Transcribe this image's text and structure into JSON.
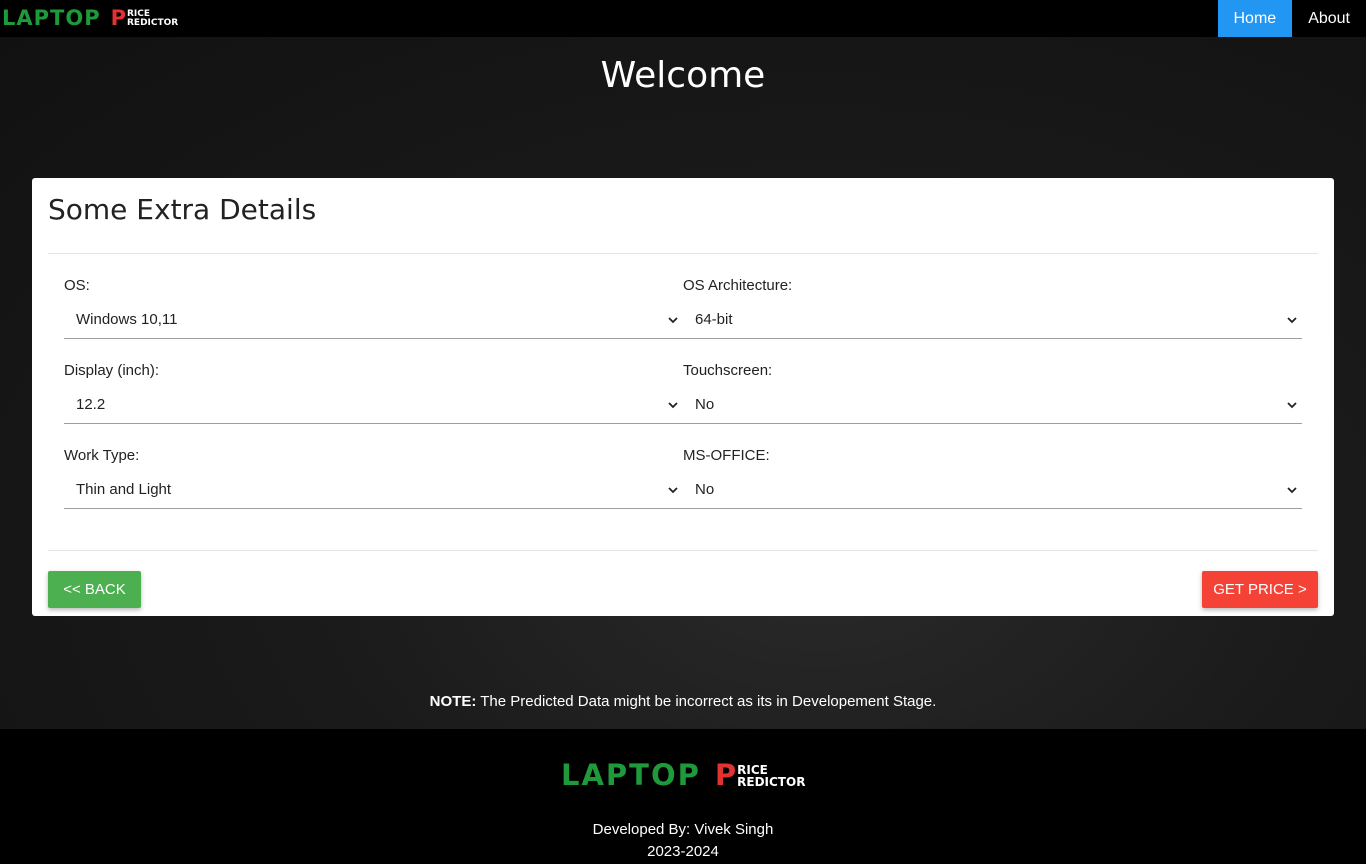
{
  "nav": {
    "logo": {
      "word": "LAPTOP",
      "p": "P",
      "line1": "RICE",
      "line2": "REDICTOR"
    },
    "links": [
      {
        "label": "Home",
        "active": true
      },
      {
        "label": "About",
        "active": false
      }
    ]
  },
  "hero": {
    "title": "Welcome"
  },
  "card": {
    "title": "Some Extra Details",
    "fields": {
      "os": {
        "label": "OS:",
        "value": "Windows 10,11"
      },
      "os_arch": {
        "label": "OS Architecture:",
        "value": "64-bit"
      },
      "display": {
        "label": "Display (inch):",
        "value": "12.2"
      },
      "touch": {
        "label": "Touchscreen:",
        "value": "No"
      },
      "work": {
        "label": "Work Type:",
        "value": "Thin and Light"
      },
      "office": {
        "label": "MS-OFFICE:",
        "value": "No"
      }
    },
    "back_label": "<< BACK",
    "get_label": "GET PRICE >"
  },
  "note": {
    "bold": "NOTE:",
    "text": " The Predicted Data might be incorrect as its in Developement Stage."
  },
  "footer": {
    "logo": {
      "word": "LAPTOP",
      "p": "P",
      "line1": "RICE",
      "line2": "REDICTOR"
    },
    "developer": "Developed By: Vivek Singh",
    "years": "2023-2024"
  },
  "colors": {
    "accent_blue": "#2196f3",
    "back_green": "#4caf50",
    "get_red": "#f44336",
    "logo_green": "#1e9a3a",
    "logo_red": "#e23232"
  }
}
